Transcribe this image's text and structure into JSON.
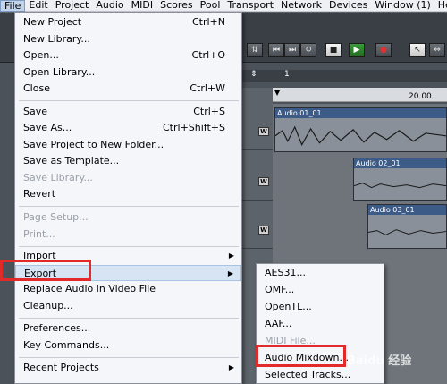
{
  "menubar": {
    "items": [
      "File",
      "Edit",
      "Project",
      "Audio",
      "MIDI",
      "Scores",
      "Pool",
      "Transport",
      "Network",
      "Devices",
      "Window (1)",
      "Help"
    ]
  },
  "file_menu": {
    "items": [
      {
        "label": "New Project",
        "shortcut": "Ctrl+N"
      },
      {
        "label": "New Library...",
        "shortcut": ""
      },
      {
        "label": "Open...",
        "shortcut": "Ctrl+O"
      },
      {
        "label": "Open Library...",
        "shortcut": ""
      },
      {
        "label": "Close",
        "shortcut": "Ctrl+W"
      },
      {
        "label": "Save",
        "shortcut": "Ctrl+S"
      },
      {
        "label": "Save As...",
        "shortcut": "Ctrl+Shift+S"
      },
      {
        "label": "Save Project to New Folder...",
        "shortcut": ""
      },
      {
        "label": "Save as Template...",
        "shortcut": ""
      },
      {
        "label": "Save Library...",
        "shortcut": ""
      },
      {
        "label": "Revert",
        "shortcut": ""
      },
      {
        "label": "Page Setup...",
        "shortcut": ""
      },
      {
        "label": "Print...",
        "shortcut": ""
      },
      {
        "label": "Import",
        "shortcut": ""
      },
      {
        "label": "Export",
        "shortcut": ""
      },
      {
        "label": "Replace Audio in Video File",
        "shortcut": ""
      },
      {
        "label": "Cleanup...",
        "shortcut": ""
      },
      {
        "label": "Preferences...",
        "shortcut": ""
      },
      {
        "label": "Key Commands...",
        "shortcut": ""
      },
      {
        "label": "Recent Projects",
        "shortcut": ""
      }
    ]
  },
  "export_menu": {
    "items": [
      "AES31...",
      "OMF...",
      "OpenTL...",
      "AAF...",
      "MIDI File...",
      "Audio Mixdown...",
      "Selected Tracks..."
    ]
  },
  "project": {
    "ruler_mark": "20.00",
    "counter_value": "1",
    "clips": [
      "Audio 01_01",
      "Audio 02_01",
      "Audio 03_01"
    ]
  },
  "watermark": {
    "text": "Baidu 经验"
  }
}
